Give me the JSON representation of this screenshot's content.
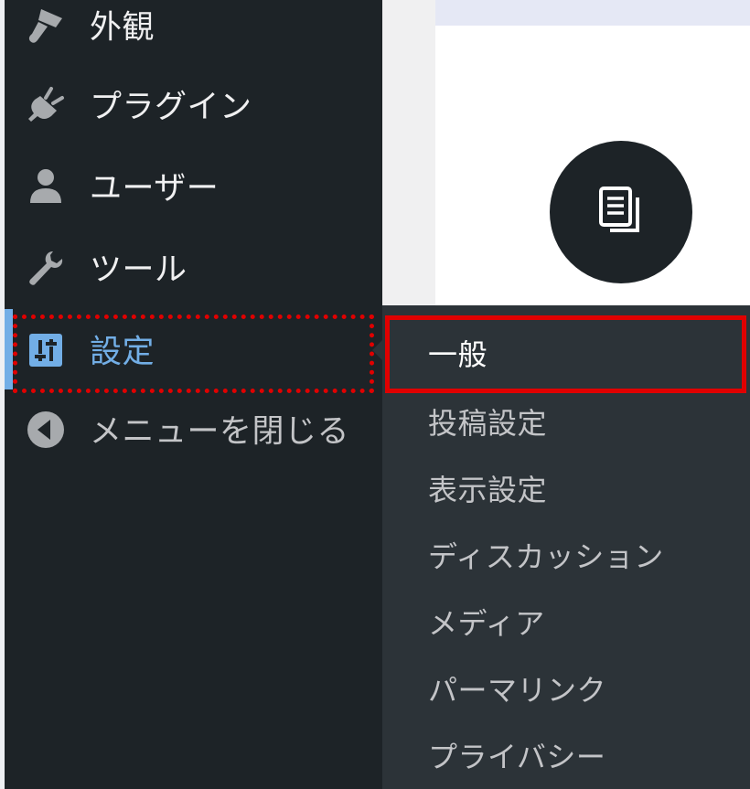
{
  "sidebar": {
    "items": [
      {
        "label": "外観",
        "icon": "paintbrush-icon"
      },
      {
        "label": "プラグイン",
        "icon": "plugin-icon"
      },
      {
        "label": "ユーザー",
        "icon": "user-icon"
      },
      {
        "label": "ツール",
        "icon": "wrench-icon"
      },
      {
        "label": "設定",
        "icon": "settings-icon",
        "current": true
      },
      {
        "label": "メニューを閉じる",
        "icon": "collapse-arrow-icon"
      }
    ]
  },
  "submenu": {
    "items": [
      {
        "label": "一般",
        "active": true
      },
      {
        "label": "投稿設定"
      },
      {
        "label": "表示設定"
      },
      {
        "label": "ディスカッション"
      },
      {
        "label": "メディア"
      },
      {
        "label": "パーマリンク"
      },
      {
        "label": "プライバシー"
      }
    ]
  },
  "content": {
    "icon": "document-icon"
  },
  "colors": {
    "menu_bg": "#1d2327",
    "submenu_bg": "#2c3338",
    "accent": "#72aee6",
    "highlight": "#e00000"
  }
}
